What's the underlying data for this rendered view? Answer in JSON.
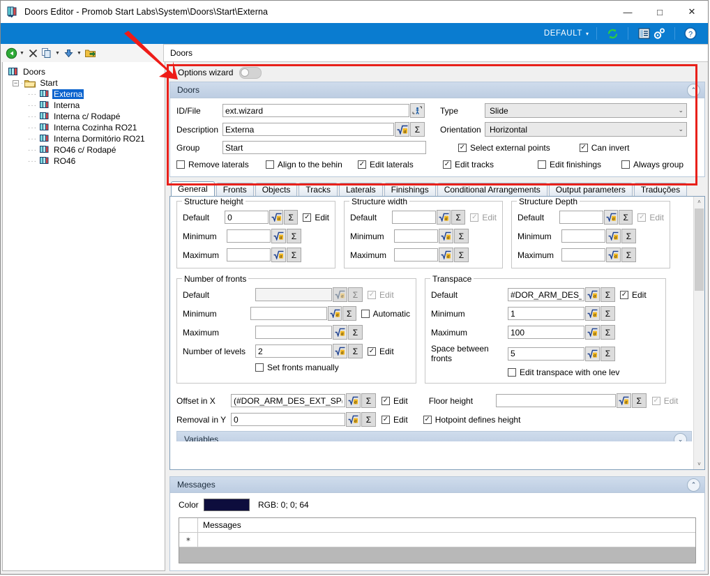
{
  "window": {
    "title": "Doors Editor - Promob Start Labs\\System\\Doors\\Start\\Externa",
    "icon": "doors-app-icon",
    "minimize": "—",
    "maximize": "□",
    "close": "✕"
  },
  "bluebar": {
    "profile_label": "DEFAULT",
    "caret": "▾",
    "icons": [
      "refresh-icon",
      "report-icon",
      "settings-gears-icon",
      "help-icon"
    ]
  },
  "toolbar": {
    "icons": [
      "back-icon",
      "back-dropdown-arrow",
      "delete-icon",
      "copy-icon",
      "copy-dropdown-arrow",
      "paste-icon",
      "paste-dropdown-arrow",
      "export-icon"
    ],
    "breadcrumb": "Doors"
  },
  "tree": {
    "root": "Doors",
    "folder": "Start",
    "items": [
      {
        "label": "Externa",
        "selected": true
      },
      {
        "label": "Interna",
        "selected": false
      },
      {
        "label": "Interna c/ Rodapé",
        "selected": false
      },
      {
        "label": "Interna Cozinha RO21",
        "selected": false
      },
      {
        "label": "Interna Dormitório RO21",
        "selected": false
      },
      {
        "label": "RO46 c/ Rodapé",
        "selected": false
      },
      {
        "label": "RO46",
        "selected": false
      }
    ]
  },
  "options_wizard": {
    "label": "Options wizard",
    "enabled": false
  },
  "doors_panel": {
    "title": "Doors",
    "collapse_icon": "chevron-double-up-icon",
    "fields": {
      "id_file_label": "ID/File",
      "id_file_value": "ext.wizard",
      "id_file_button": "wizard-picker-icon",
      "description_label": "Description",
      "description_value": "Externa",
      "group_label": "Group",
      "group_value": "Start",
      "type_label": "Type",
      "type_value": "Slide",
      "orientation_label": "Orientation",
      "orientation_value": "Horizontal"
    },
    "checkboxes": [
      {
        "label": "Select external points",
        "checked": true
      },
      {
        "label": "Can invert",
        "checked": true
      },
      {
        "label": "Remove laterals",
        "checked": false
      },
      {
        "label": "Align to the behin",
        "checked": false
      },
      {
        "label": "Edit laterals",
        "checked": true
      },
      {
        "label": "Edit tracks",
        "checked": true
      },
      {
        "label": "Edit finishings",
        "checked": false
      },
      {
        "label": "Always group",
        "checked": false
      }
    ]
  },
  "tabs": [
    {
      "label": "General",
      "active": true
    },
    {
      "label": "Fronts",
      "active": false
    },
    {
      "label": "Objects",
      "active": false
    },
    {
      "label": "Tracks",
      "active": false
    },
    {
      "label": "Laterals",
      "active": false
    },
    {
      "label": "Finishings",
      "active": false
    },
    {
      "label": "Conditional Arrangements",
      "active": false
    },
    {
      "label": "Output parameters",
      "active": false
    },
    {
      "label": "Traduções",
      "active": false
    }
  ],
  "general_tab": {
    "structure_height": {
      "legend": "Structure height",
      "rows": [
        {
          "label": "Default",
          "value": "0"
        },
        {
          "label": "Minimum",
          "value": ""
        },
        {
          "label": "Maximum",
          "value": ""
        }
      ],
      "edit_label": "Edit",
      "edit_checked": true,
      "edit_disabled": false
    },
    "structure_width": {
      "legend": "Structure width",
      "rows": [
        {
          "label": "Default",
          "value": ""
        },
        {
          "label": "Minimum",
          "value": ""
        },
        {
          "label": "Maximum",
          "value": ""
        }
      ],
      "edit_label": "Edit",
      "edit_checked": true,
      "edit_disabled": true
    },
    "structure_depth": {
      "legend": "Structure Depth",
      "rows": [
        {
          "label": "Default",
          "value": ""
        },
        {
          "label": "Minimum",
          "value": ""
        },
        {
          "label": "Maximum",
          "value": ""
        }
      ],
      "edit_label": "Edit",
      "edit_checked": true,
      "edit_disabled": true
    },
    "number_of_fronts": {
      "legend": "Number of fronts",
      "rows": [
        {
          "label": "Default",
          "value": ""
        },
        {
          "label": "Minimum",
          "value": ""
        },
        {
          "label": "Maximum",
          "value": ""
        },
        {
          "label": "Number of levels",
          "value": "2"
        }
      ],
      "edit_default_label": "Edit",
      "edit_default_checked": true,
      "edit_default_disabled": true,
      "automatic_label": "Automatic",
      "automatic_checked": false,
      "edit_levels_label": "Edit",
      "edit_levels_checked": true,
      "set_fronts_label": "Set fronts manually",
      "set_fronts_checked": false
    },
    "transpace": {
      "legend": "Transpace",
      "rows": [
        {
          "label": "Default",
          "value": "#DOR_ARM_DES_E"
        },
        {
          "label": "Minimum",
          "value": "1"
        },
        {
          "label": "Maximum",
          "value": "100"
        },
        {
          "label": "Space between fronts",
          "value": "5"
        }
      ],
      "edit_label": "Edit",
      "edit_checked": true,
      "one_level_label": "Edit transpace with one lev",
      "one_level_checked": false
    },
    "offset_x": {
      "label": "Offset in X",
      "value": "(#DOR_ARM_DES_EXT_SP(",
      "edit_label": "Edit",
      "edit_checked": true
    },
    "removal_y": {
      "label": "Removal in Y",
      "value": "0",
      "edit_label": "Edit",
      "edit_checked": true
    },
    "floor_height": {
      "label": "Floor height",
      "value": "",
      "edit_label": "Edit",
      "edit_checked": true,
      "edit_disabled": true
    },
    "hotpoint": {
      "label": "Hotpoint defines height",
      "checked": true
    },
    "variables_panel_title": "Variables",
    "formula_button": "formula-sqrt-icon",
    "sum_button": "sigma-sum-icon",
    "scrollbar": {
      "up": "˄",
      "down": "˅"
    }
  },
  "messages_panel": {
    "title": "Messages",
    "collapse_icon": "chevron-double-up-icon",
    "color_label": "Color",
    "color_swatch": "#0d0d3d",
    "rgb_text": "RGB: 0; 0; 64",
    "grid_header": "Messages",
    "row_marker": "✶",
    "rows": [
      {
        "message": ""
      }
    ]
  },
  "annotation": {
    "arrow_color": "#e8201a",
    "box_color": "#e8201a"
  }
}
